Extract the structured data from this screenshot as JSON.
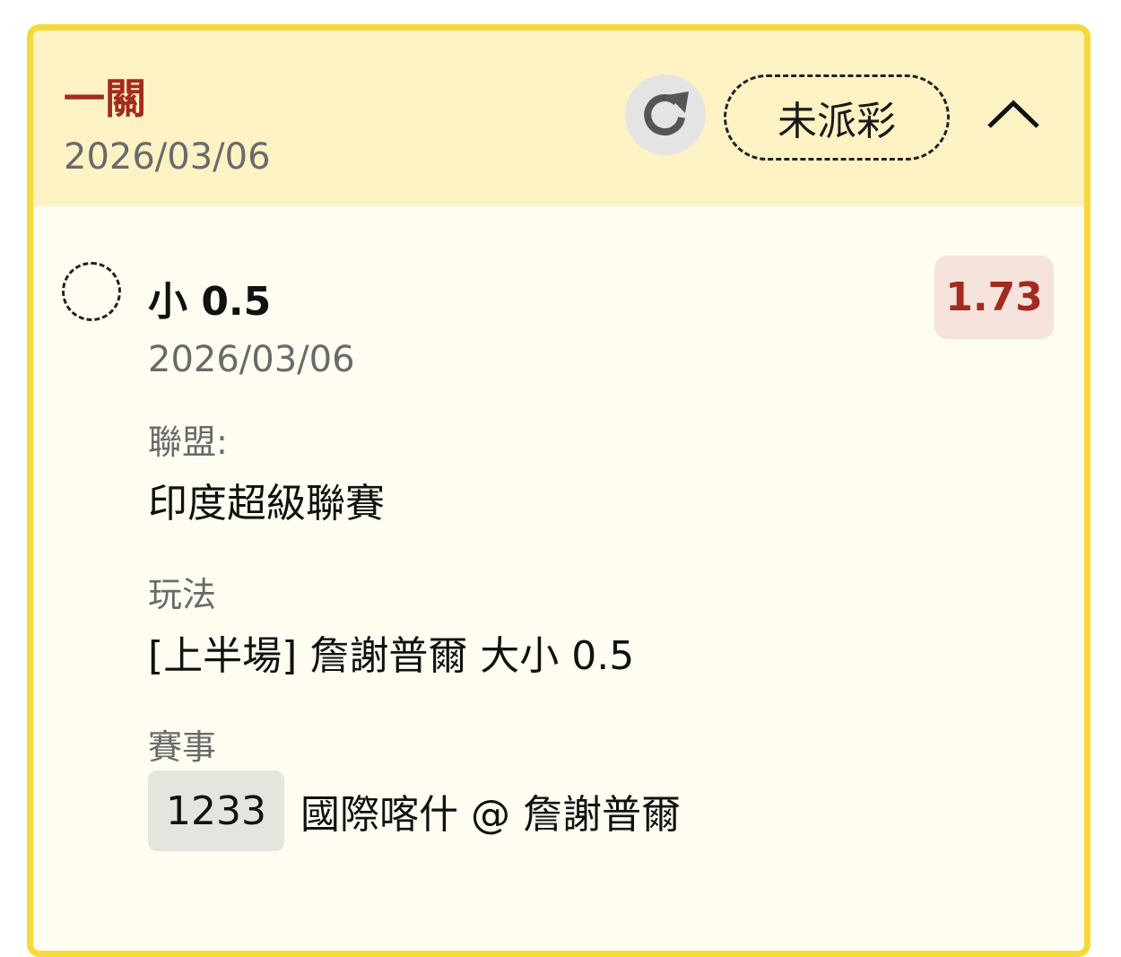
{
  "header": {
    "bet_type": "一關",
    "date": "2026/03/06",
    "status": "未派彩",
    "icons": {
      "refresh": "refresh-icon",
      "collapse": "chevron-up-icon"
    }
  },
  "leg": {
    "selection": "小 0.5",
    "date": "2026/03/06",
    "odds": "1.73",
    "league_label": "聯盟:",
    "league": "印度超級聯賽",
    "market_label": "玩法",
    "market": "[上半場] 詹謝普爾 大小 0.5",
    "event_label": "賽事",
    "event_id": "1233",
    "event_name": "國際喀什 @ 詹謝普爾"
  },
  "colors": {
    "accent_red": "#a32a1f",
    "border_yellow": "#f7d93a",
    "header_bg": "#fdf2c4"
  }
}
